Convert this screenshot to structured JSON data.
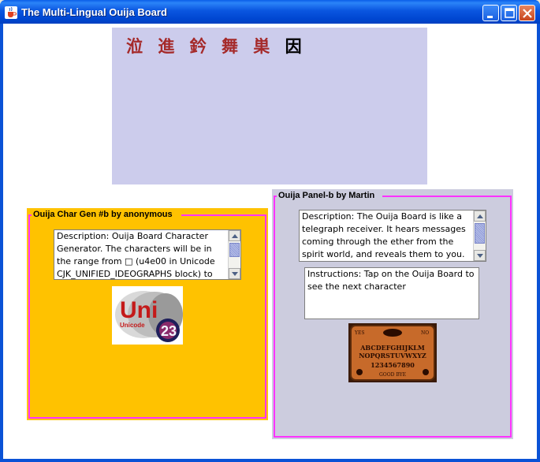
{
  "window": {
    "title": "The Multi-Lingual Ouija Board",
    "icon": "java-cup-icon",
    "controls": [
      "minimize",
      "maximize",
      "close"
    ]
  },
  "top_panel": {
    "characters": [
      "涖",
      "進",
      "鈐",
      "舞",
      "巣"
    ],
    "current_character": "因"
  },
  "left_panel": {
    "title": "Ouija Char Gen #b by anonymous",
    "description": "Description: Ouija Board Character Generator.  The characters will be in the range from □ (u4e00 in Unicode CJK_UNIFIED_IDEOGRAPHS block) to",
    "image": {
      "name": "unicode-logo",
      "text": "Unicode",
      "letters": "Uni",
      "badge": "23"
    }
  },
  "right_panel": {
    "title": "Ouija Panel-b by Martin",
    "description": "Description: The Ouija Board is like a telegraph receiver. It hears messages coming through the ether from the spirit world, and reveals them to you. The font",
    "instructions": "Instructions: Tap on the Ouija Board to see the next character",
    "image": {
      "name": "ouija-board",
      "row1": "ABCDEFGHIJKLM",
      "row2": "NOPQRSTUVWXYZ",
      "row3": "1234567890",
      "footer": "GOOD BYE",
      "yes": "YES",
      "no": "NO"
    }
  },
  "colors": {
    "title_bar": "#0a56e0",
    "top_panel_bg": "#ccccec",
    "left_panel_bg": "#ffc200",
    "right_panel_bg": "#ccccde",
    "group_border": "#ff33ff",
    "cjk_char": "#a52a2a"
  }
}
